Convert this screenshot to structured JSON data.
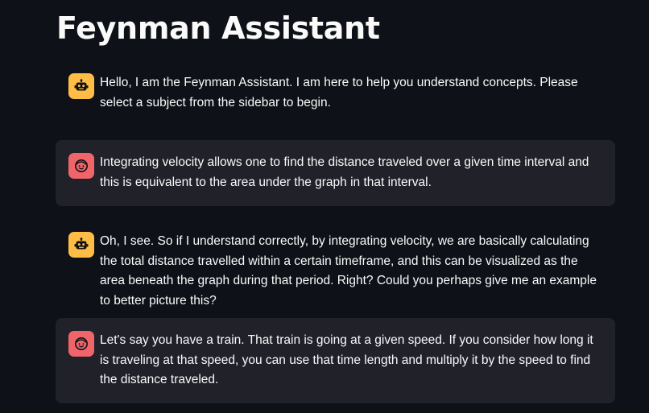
{
  "app": {
    "title": "Feynman Assistant"
  },
  "chat": {
    "messages": [
      {
        "role": "assistant",
        "avatar_icon": "bot-icon",
        "text": "Hello, I am the Feynman Assistant. I am here to help you understand concepts. Please select a subject from the sidebar to begin."
      },
      {
        "role": "user",
        "avatar_icon": "user-face-icon",
        "text": "Integrating velocity allows one to find the distance traveled over a given time interval and this is equivalent to the area under the graph in that interval."
      },
      {
        "role": "assistant",
        "avatar_icon": "bot-icon",
        "text": "Oh, I see. So if I understand correctly, by integrating velocity, we are basically calculating the total distance travelled within a certain timeframe, and this can be visualized as the area beneath the graph during that period. Right? Could you perhaps give me an example to better picture this?"
      },
      {
        "role": "user",
        "avatar_icon": "user-face-icon",
        "text": "Let's say you have a train. That train is going at a given speed. If you consider how long it is traveling at that speed, you can use that time length and multiply it by the speed to find the distance traveled."
      }
    ]
  },
  "colors": {
    "background": "#0e1117",
    "user_bubble": "#262730",
    "assistant_avatar": "#ffbd45",
    "user_avatar": "#f0656a",
    "text": "#fafafa"
  }
}
